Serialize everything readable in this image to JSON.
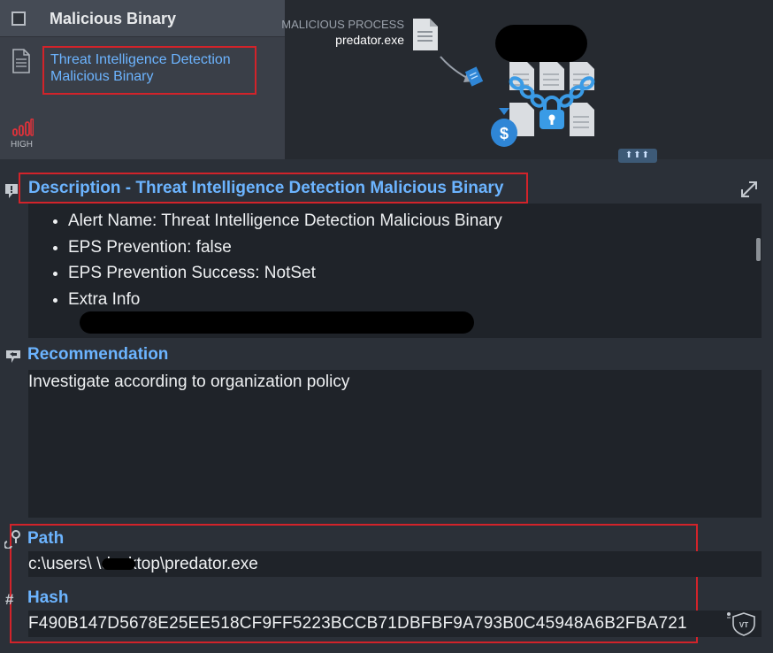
{
  "alert": {
    "title": "Malicious Binary",
    "detection_line1": "Threat Intelligence Detection",
    "detection_line2": "Malicious Binary",
    "severity": "HIGH"
  },
  "process": {
    "label": "MALICIOUS PROCESS",
    "name": "predator.exe"
  },
  "description": {
    "title": "Description - Threat Intelligence Detection Malicious Binary",
    "items": [
      "Alert Name: Threat Intelligence Detection Malicious Binary",
      "EPS Prevention: false",
      "EPS Prevention Success: NotSet",
      "Extra Info"
    ]
  },
  "recommendation": {
    "title": "Recommendation",
    "text": "Investigate according to organization policy"
  },
  "path": {
    "title": "Path",
    "value": "c:\\users\\        \\desktop\\predator.exe"
  },
  "hash": {
    "title": "Hash",
    "value": "F490B147D5678E25EE518CF9FF5223BCCB71DBFBF9A793B0C45948A6B2FBA721"
  },
  "icons": {
    "checkbox": "checkbox-icon",
    "document": "document-icon",
    "severity": "signal-bars-icon",
    "process": "file-icon",
    "expand": "expand-arrows-icon",
    "virustotal": "virustotal-shield-icon"
  },
  "colors": {
    "accent": "#6cb4ff",
    "highlight_border": "#d2232a",
    "severity": "#e0323a",
    "panel": "#1f2329"
  }
}
